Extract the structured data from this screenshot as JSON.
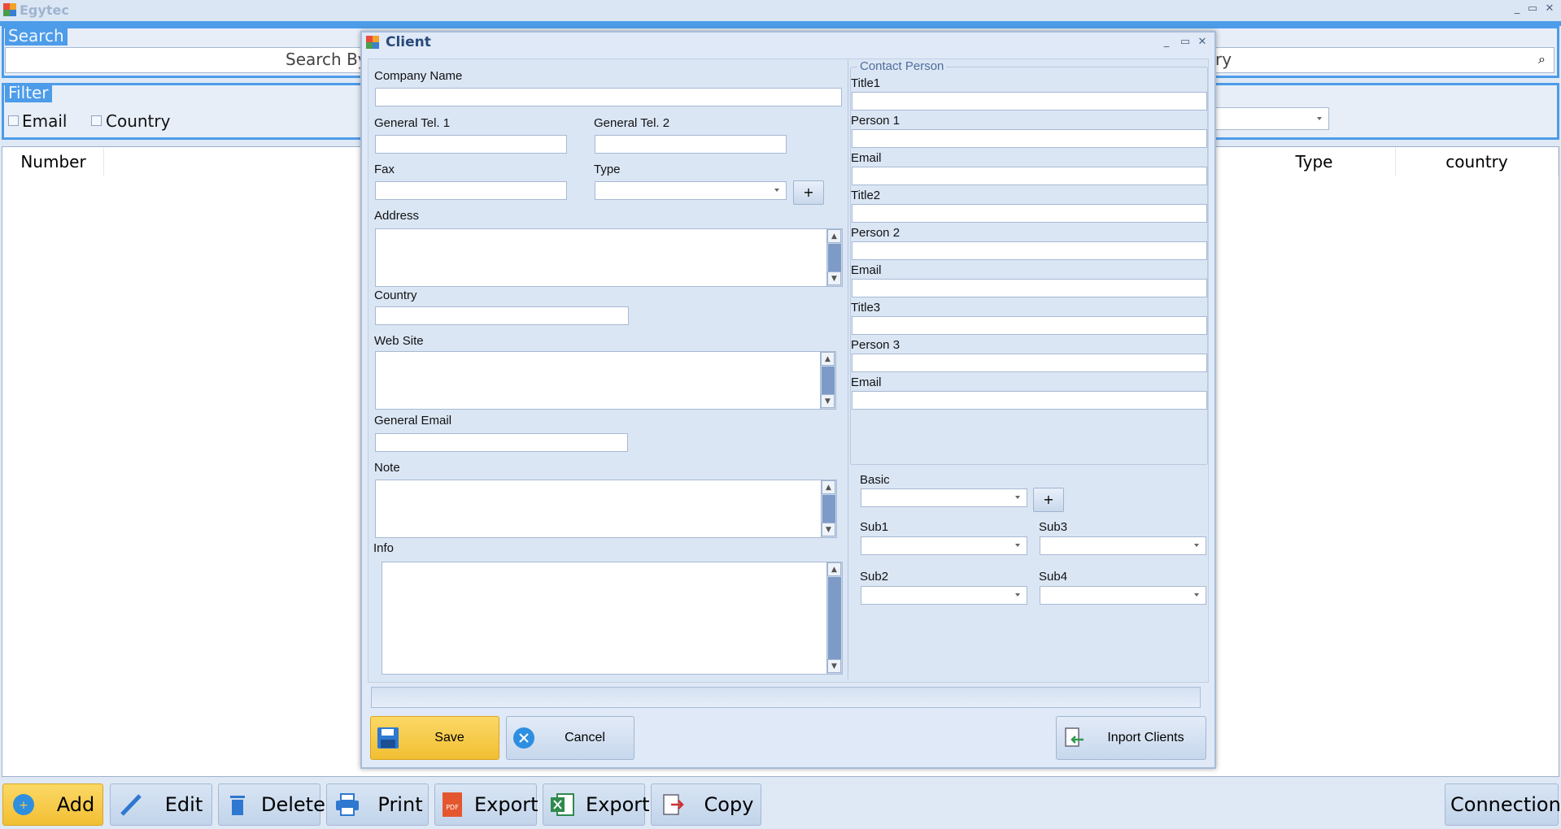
{
  "app": {
    "title": "Egytec"
  },
  "search": {
    "group_title": "Search",
    "search_by_label": "Search By",
    "right_partial": "ry"
  },
  "filter": {
    "group_title": "Filter",
    "email_label": "Email",
    "country_label": "Country"
  },
  "grid": {
    "columns": {
      "number": "Number",
      "type": "Type",
      "country": "country"
    }
  },
  "toolbar": {
    "add": "Add",
    "edit": "Edit",
    "delete": "Delete",
    "print": "Print",
    "export_pdf": "Export",
    "export_excel": "Export",
    "copy": "Copy",
    "connection": "Connection",
    "pdf_icon_text": "PDF"
  },
  "dialog": {
    "title": "Client",
    "company_name": "Company Name",
    "general_tel_1": "General Tel. 1",
    "general_tel_2": "General Tel. 2",
    "fax": "Fax",
    "type": "Type",
    "address": "Address",
    "country": "Country",
    "web_site": "Web Site",
    "general_email": "General Email",
    "note": "Note",
    "info": "Info",
    "contact_person": {
      "title": "Contact Person",
      "title1": "Title1",
      "person1": "Person 1",
      "email1": "Email",
      "title2": "Title2",
      "person2": "Person 2",
      "email2": "Email",
      "title3": "Title3",
      "person3": "Person 3",
      "email3": "Email"
    },
    "basic": "Basic",
    "sub1": "Sub1",
    "sub2": "Sub2",
    "sub3": "Sub3",
    "sub4": "Sub4",
    "plus": "+",
    "save": "Save",
    "cancel": "Cancel",
    "import_clients": "Inport Clients"
  },
  "colors": {
    "accent": "#4d9ce9",
    "add_button": "#f7c948",
    "save_button": "#f7c948"
  }
}
